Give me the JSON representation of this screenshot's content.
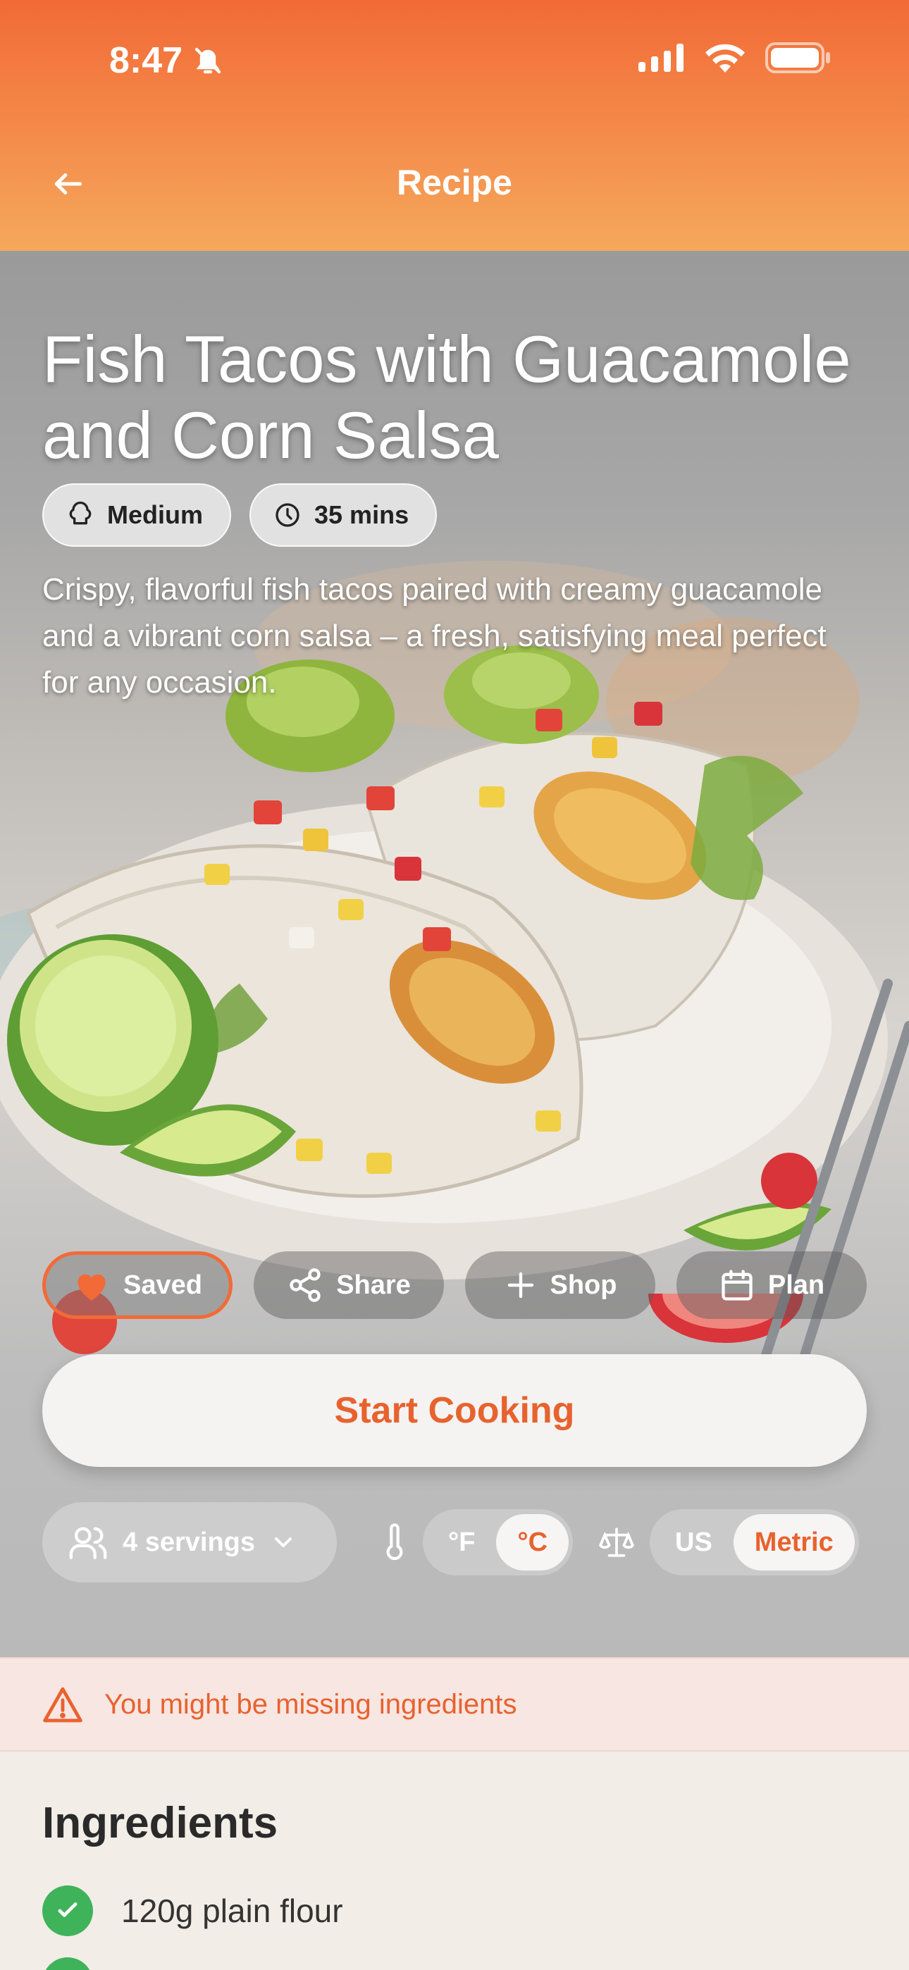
{
  "status_bar": {
    "time": "8:47"
  },
  "header": {
    "title": "Recipe"
  },
  "recipe": {
    "title": "Fish Tacos with Guacamole and Corn Salsa",
    "difficulty": "Medium",
    "duration": "35 mins",
    "description": "Crispy, flavorful fish tacos paired with creamy guacamole and a vibrant corn salsa – a fresh, satisfying meal perfect for any occasion."
  },
  "actions": {
    "saved": "Saved",
    "share": "Share",
    "shop": "Shop",
    "plan": "Plan"
  },
  "start_cooking": "Start Cooking",
  "controls": {
    "servings": "4 servings",
    "temp_f": "°F",
    "temp_c": "°C",
    "temp_selected": "°C",
    "unit_us": "US",
    "unit_metric": "Metric",
    "unit_selected": "Metric"
  },
  "alert": {
    "text": "You might be missing ingredients"
  },
  "ingredients": {
    "title": "Ingredients",
    "items": [
      {
        "label": "120g plain flour",
        "checked": true
      }
    ]
  },
  "colors": {
    "accent": "#e8622e",
    "header_top": "#f26a36",
    "header_bottom": "#f5a85c",
    "check_green": "#3fb35a"
  }
}
